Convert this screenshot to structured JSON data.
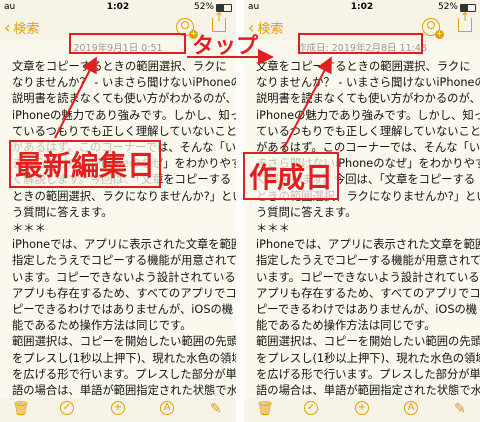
{
  "left_phone": {
    "status": {
      "carrier": "au",
      "time": "1:02",
      "battery": "52%"
    },
    "nav": {
      "back_label": "検索"
    },
    "date_text": "2019年9月1日 0:51",
    "lines": [
      "文章をコピーするときの範囲選択、ラクに",
      "なりませんか？ - いまさら聞けないiPhoneのなぜ",
      "説明書を読まなくても使い方がわかるのが、",
      "iPhoneの魅力であり強みです。しかし、知っ",
      "ているつもりでも正しく理解していないこと",
      "があるはず。このコーナーでは、そんな「い",
      "まさら聞けないiPhoneのなぜ」をわかりやす",
      "く解説します。今回は、「文章をコピーする",
      "ときの範囲選択、ラクになりませんか?」とい",
      "う質問に答えます。",
      "＊＊＊",
      "iPhoneでは、アプリに表示された文章を範囲",
      "指定したうえでコピーする機能が用意されて",
      "います。コピーできないよう設計されている",
      "アプリも存在するため、すべてのアプリでコ",
      "ピーできるわけではありませんが、iOSの機",
      "能であるため操作方法は同じです。",
      "範囲選択は、コピーを開始したい範囲の先頭",
      "をプレスし(1秒以上押下)、現れた水色の領域",
      "を広げる形で行います。プレスした部分が単",
      "語の場合は、単語が範囲指定された状態で水"
    ]
  },
  "right_phone": {
    "status": {
      "carrier": "au",
      "time": "1:02",
      "battery": "52%"
    },
    "nav": {
      "back_label": "検索"
    },
    "date_text": "作成日: 2019年2月8日 11:48",
    "lines": [
      "文章をコピーするときの範囲選択、ラクに",
      "なりませんか？ - いまさら聞けないiPhoneのなぜ",
      "説明書を読まなくても使い方がわかるのが、",
      "iPhoneの魅力であり強みです。しかし、知っ",
      "ているつもりでも正しく理解していないこと",
      "があるはず。このコーナーでは、そんな「い",
      "まさら聞けないiPhoneのなぜ」をわかりやす",
      "く解説します。今回は、「文章をコピーする",
      "ときの範囲選択、ラクになりませんか?」とい",
      "う質問に答えます。",
      "＊＊＊",
      "iPhoneでは、アプリに表示された文章を範囲",
      "指定したうえでコピーする機能が用意されて",
      "います。コピーできないよう設計されている",
      "アプリも存在するため、すべてのアプリでコ",
      "ピーできるわけではありませんが、iOSの機",
      "能であるため操作方法は同じです。",
      "範囲選択は、コピーを開始したい範囲の先頭",
      "をプレスし(1秒以上押下)、現れた水色の領域",
      "を広げる形で行います。プレスした部分が単",
      "語の場合は、単語が範囲指定された状態で水"
    ]
  },
  "annotations": {
    "tap_label": "タップ",
    "last_edited_label": "最新編集日",
    "created_label": "作成日"
  },
  "colors": {
    "accent": "#e1a100",
    "annotation_red": "#e21f1f",
    "note_bg": "#fbf8ee"
  }
}
